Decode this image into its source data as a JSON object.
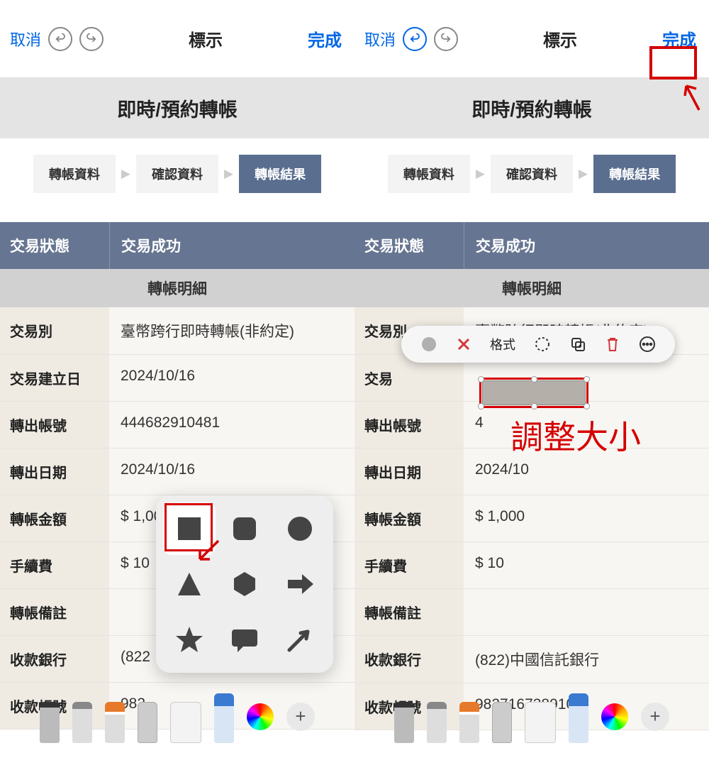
{
  "topbar": {
    "cancel": "取消",
    "title": "標示",
    "done": "完成"
  },
  "section_title": "即時/預約轉帳",
  "steps": {
    "s1": "轉帳資料",
    "s2": "確認資料",
    "s3": "轉帳結果"
  },
  "status": {
    "label": "交易狀態",
    "value": "交易成功"
  },
  "table_header": "轉帳明細",
  "rows_left": [
    {
      "label": "交易別",
      "value": "臺幣跨行即時轉帳(非約定)"
    },
    {
      "label": "交易建立日",
      "value": "2024/10/16"
    },
    {
      "label": "轉出帳號",
      "value": "444682910481"
    },
    {
      "label": "轉出日期",
      "value": "2024/10/16"
    },
    {
      "label": "轉帳金額",
      "value": "$ 1,000"
    },
    {
      "label": "手續費",
      "value": "$ 10"
    },
    {
      "label": "轉帳備註",
      "value": ""
    },
    {
      "label": "收款銀行",
      "value": "(822"
    },
    {
      "label": "收款帳號",
      "value": "982"
    }
  ],
  "rows_right": [
    {
      "label": "交易別",
      "value": "臺幣跨行即時轉帳(非約定)"
    },
    {
      "label": "交易",
      "value": ""
    },
    {
      "label": "轉出帳號",
      "value": "4"
    },
    {
      "label": "轉出日期",
      "value": "2024/10"
    },
    {
      "label": "轉帳金額",
      "value": "$ 1,000"
    },
    {
      "label": "手續費",
      "value": "$ 10"
    },
    {
      "label": "轉帳備註",
      "value": ""
    },
    {
      "label": "收款銀行",
      "value": "(822)中國信託銀行"
    },
    {
      "label": "收款帳號",
      "value": "982716738910"
    }
  ],
  "context": {
    "format": "格式"
  },
  "annotation": {
    "resize": "調整大小"
  }
}
